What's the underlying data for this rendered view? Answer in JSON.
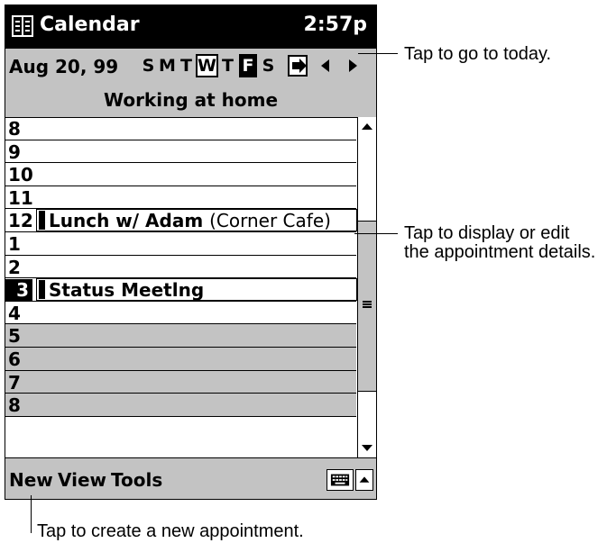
{
  "titlebar": {
    "app_name": "Calendar",
    "time": "2:57p",
    "icon": "calendar-app-icon"
  },
  "date_bar": {
    "date": "Aug 20, 99",
    "days": [
      "S",
      "M",
      "T",
      "W",
      "T",
      "F",
      "S"
    ],
    "today_day": "W",
    "selected_day": "F",
    "goto_today_icon": "goto-today-icon",
    "prev_icon": "left-arrow-icon",
    "next_icon": "right-arrow-icon"
  },
  "banner": "Working at home",
  "agenda": {
    "rows": [
      {
        "hour": "8"
      },
      {
        "hour": "9"
      },
      {
        "hour": "10"
      },
      {
        "hour": "11"
      },
      {
        "hour": "12",
        "subject": "Lunch w/ Adam",
        "location": "(Corner Cafe)"
      },
      {
        "hour": "1"
      },
      {
        "hour": "2"
      },
      {
        "hour": "3",
        "subject": "Status Meetlng"
      },
      {
        "hour": "4"
      },
      {
        "hour": "5"
      },
      {
        "hour": "6"
      },
      {
        "hour": "7"
      },
      {
        "hour": "8"
      }
    ]
  },
  "menu": {
    "items": [
      "New",
      "View",
      "Tools"
    ],
    "keyboard_icon": "keyboard-icon",
    "sip_icon": "up-arrow-icon"
  },
  "callouts": {
    "today": "Tap to go to today.",
    "details_line1": "Tap to display or edit",
    "details_line2": "the appointment details.",
    "new": "Tap to create a new appointment."
  },
  "colors": {
    "chrome_gray": "#c3c3c3",
    "title_bar": "#000000"
  }
}
